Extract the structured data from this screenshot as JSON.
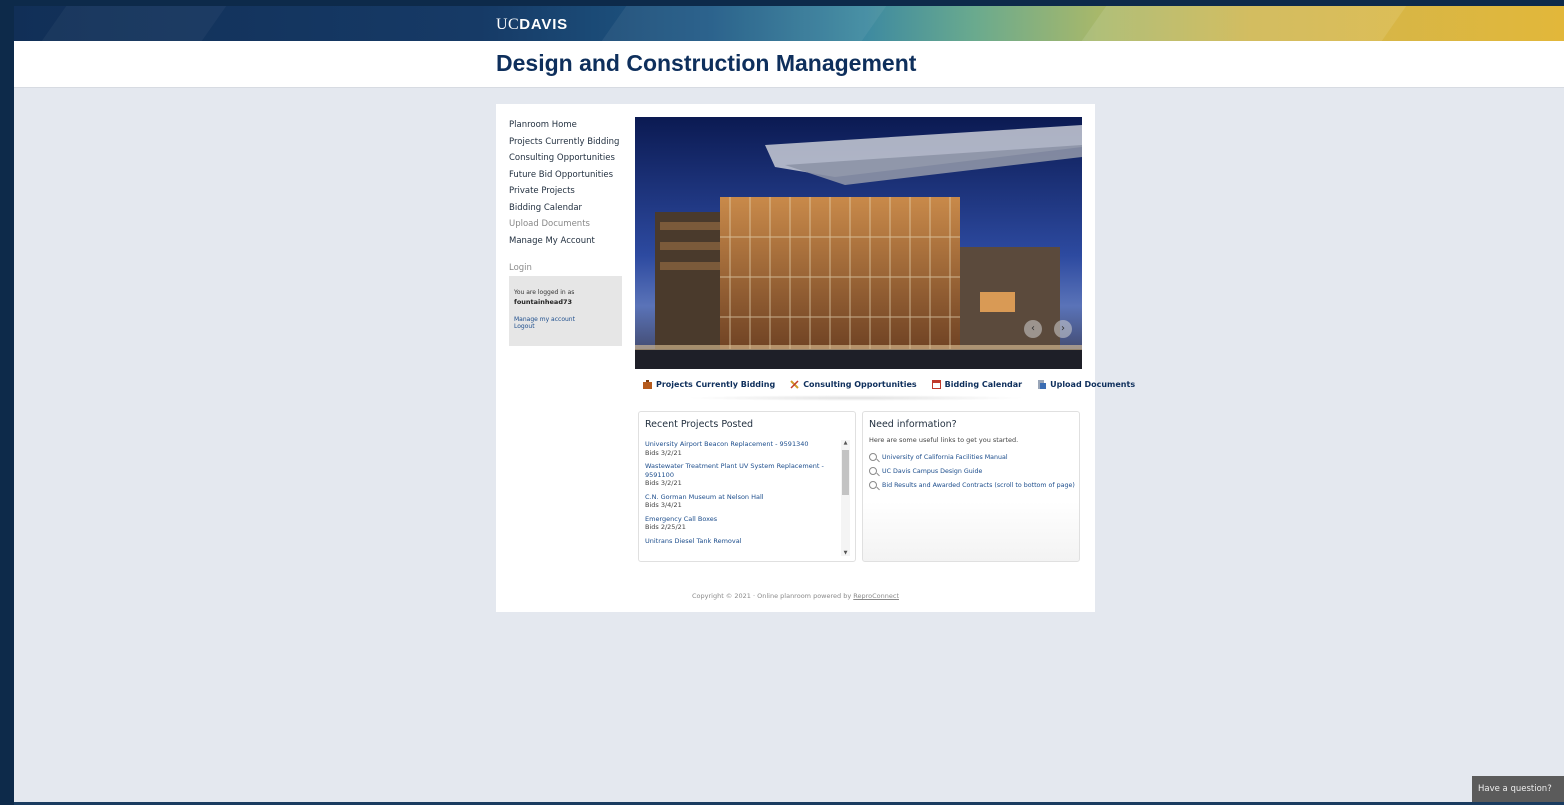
{
  "header": {
    "logo_uc": "UC",
    "logo_davis": "DAVIS",
    "site_title": "Design and Construction Management"
  },
  "nav": {
    "items": [
      {
        "label": "Planroom Home"
      },
      {
        "label": "Projects Currently Bidding"
      },
      {
        "label": "Consulting Opportunities"
      },
      {
        "label": "Future Bid Opportunities"
      },
      {
        "label": "Private Projects"
      },
      {
        "label": "Bidding Calendar"
      },
      {
        "label": "Upload Documents"
      },
      {
        "label": "Manage My Account"
      }
    ]
  },
  "login": {
    "heading": "Login",
    "logged_in_text": "You are logged in as",
    "username": "fountainhead73",
    "manage_link": "Manage my account",
    "logout_link": "Logout"
  },
  "quicklinks": {
    "projects": "Projects Currently Bidding",
    "consulting": "Consulting Opportunities",
    "calendar": "Bidding Calendar",
    "upload": "Upload Documents"
  },
  "recent": {
    "heading": "Recent Projects Posted",
    "projects": [
      {
        "name": "University Airport Beacon Replacement - 9591340",
        "bids": "Bids 3/2/21"
      },
      {
        "name": "Wastewater Treatment Plant UV System Replacement - 9591100",
        "bids": "Bids 3/2/21"
      },
      {
        "name": "C.N. Gorman Museum at Nelson Hall",
        "bids": "Bids 3/4/21"
      },
      {
        "name": "Emergency Call Boxes",
        "bids": "Bids 2/25/21"
      },
      {
        "name": "Unitrans Diesel Tank Removal",
        "bids": ""
      }
    ]
  },
  "info": {
    "heading": "Need information?",
    "subtitle": "Here are some useful links to get you started.",
    "links": [
      {
        "label": "University of California Facilities Manual"
      },
      {
        "label": "UC Davis Campus Design Guide"
      },
      {
        "label": "Bid Results and Awarded Contracts (scroll to bottom of page)"
      }
    ]
  },
  "footer": {
    "copyright": "Copyright © 2021 · Online planroom powered by",
    "link": "ReproConnect"
  },
  "chat": {
    "label": "Have a question?"
  },
  "colors": {
    "brand_navy": "#0e2f5c",
    "link_blue": "#1c4d8c",
    "page_bg": "#e4e8ef",
    "gold": "#e2b73a"
  }
}
